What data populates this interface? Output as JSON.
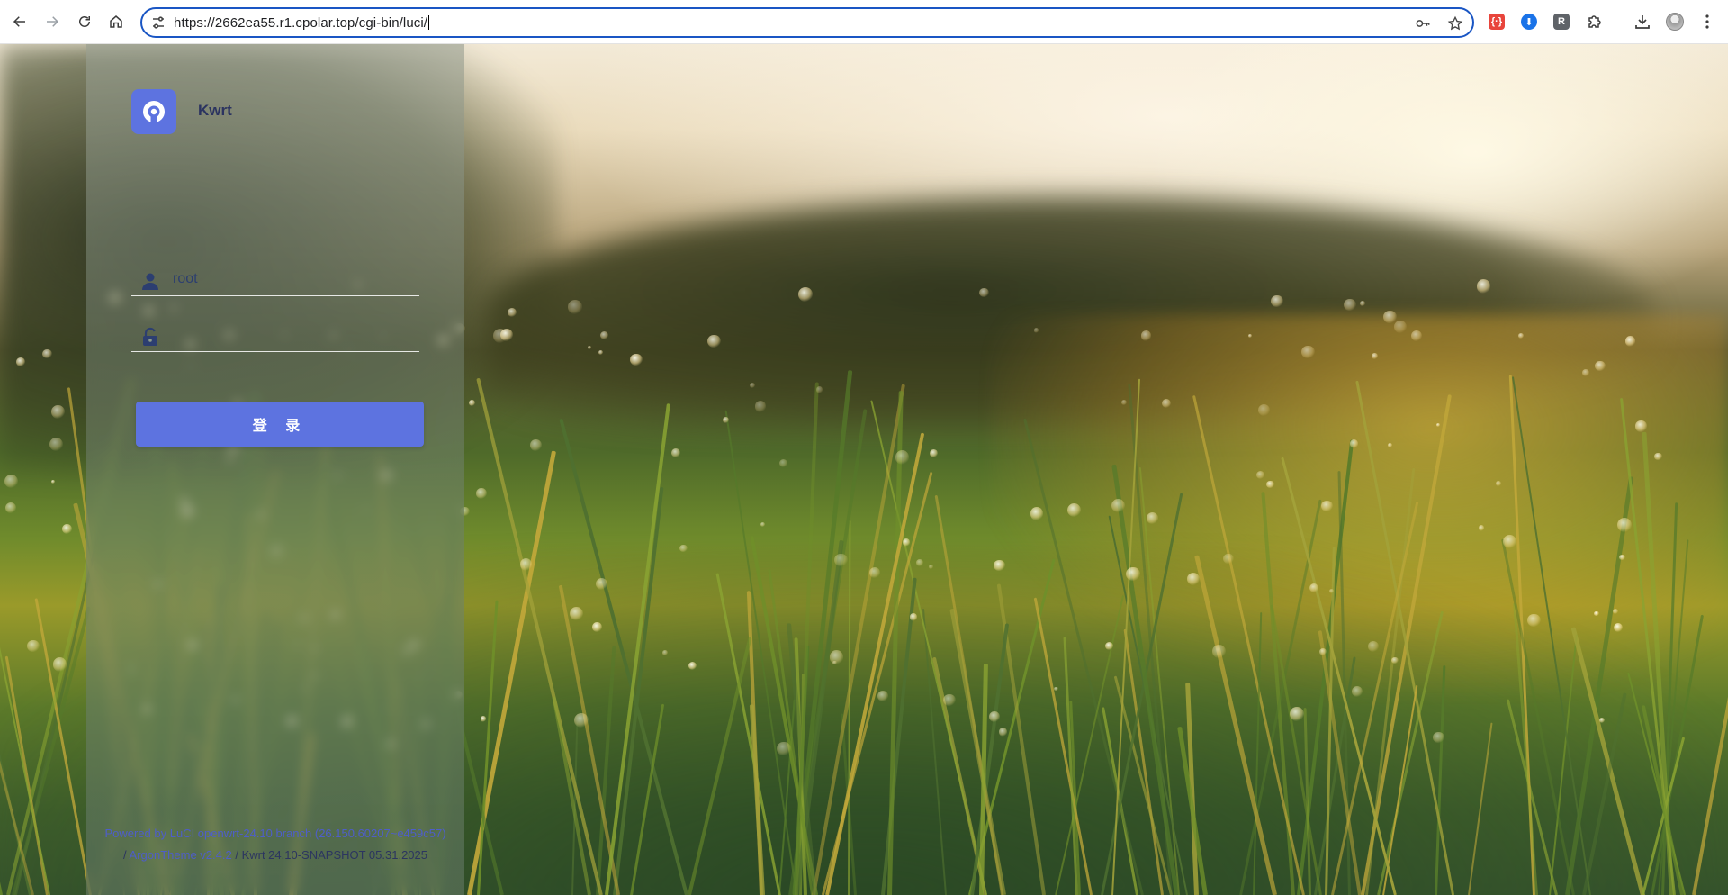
{
  "browser": {
    "url": "https://2662ea55.r1.cpolar.top/cgi-bin/luci/",
    "icons": {
      "back": "back-arrow-icon",
      "forward": "forward-arrow-icon",
      "reload": "reload-icon",
      "home": "home-icon",
      "site_settings": "tune-icon",
      "password": "key-icon",
      "bookmark": "star-icon",
      "downloads": "download-icon",
      "menu": "kebab-menu-icon"
    },
    "extensions": [
      {
        "name": "ext-red-icon",
        "glyph": "{·}",
        "color": "#e8453c"
      },
      {
        "name": "ext-blue-icon",
        "glyph": "⬇",
        "color": "#1a73e8"
      },
      {
        "name": "ext-r-icon",
        "glyph": "R",
        "color": "#5f6368"
      }
    ]
  },
  "login": {
    "brand_name": "Kwrt",
    "username_value": "root",
    "password_value": "",
    "login_button_label": "登 录"
  },
  "footer": {
    "line1": "Powered by LuCI openwrt-24.10 branch (26.150.60207~e459c57)",
    "sep": "/",
    "theme_link": "ArgonTheme v2.4.2",
    "line2_tail": "/ Kwrt 24.10-SNAPSHOT 05.31.2025"
  },
  "colors": {
    "accent": "#5d73e0",
    "omnibox_border": "#1a56c4",
    "footer_link": "#4e5ec9"
  }
}
